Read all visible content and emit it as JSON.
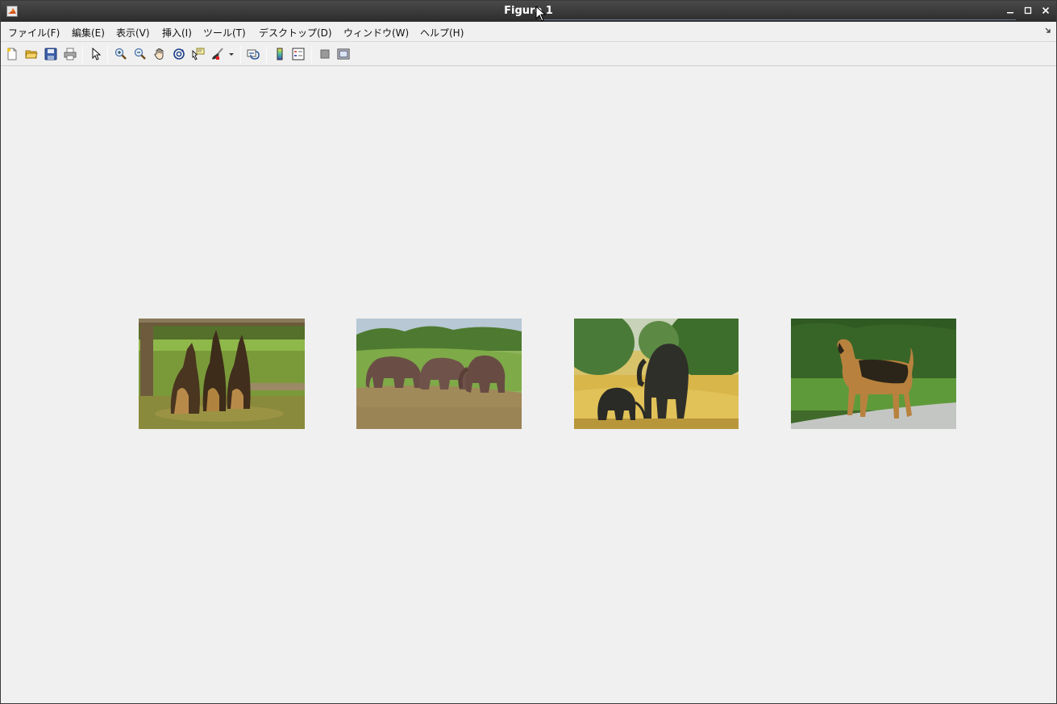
{
  "window": {
    "title": "Figure 1",
    "app_icon": "matlab-logo-icon",
    "controls": [
      "minimize-icon",
      "maximize-icon",
      "close-icon"
    ]
  },
  "menubar": {
    "items": [
      {
        "label": "ファイル(F)"
      },
      {
        "label": "編集(E)"
      },
      {
        "label": "表示(V)"
      },
      {
        "label": "挿入(I)"
      },
      {
        "label": "ツール(T)"
      },
      {
        "label": "デスクトップ(D)"
      },
      {
        "label": "ウィンドウ(W)"
      },
      {
        "label": "ヘルプ(H)"
      }
    ]
  },
  "toolbar": {
    "tools": [
      "new-figure-icon",
      "open-file-icon",
      "save-icon",
      "print-icon",
      "edit-plot-arrow-icon",
      "zoom-in-icon",
      "zoom-out-icon",
      "pan-hand-icon",
      "rotate-3d-icon",
      "data-cursor-icon",
      "brush-icon",
      "brush-dropdown-icon",
      "link-plot-icon",
      "colorbar-icon",
      "legend-icon",
      "hide-plot-tools-icon",
      "show-plot-tools-icon"
    ]
  },
  "images": [
    {
      "subject": "three german shepherd dogs sitting on grass by a fence"
    },
    {
      "subject": "three elephants on a grassy hill"
    },
    {
      "subject": "adult elephant and calf in yellow grass"
    },
    {
      "subject": "airedale terrier standing on lawn"
    }
  ],
  "colors": {
    "titlebar": "#2c2c2c",
    "background": "#f0f0f0",
    "menu_text": "#111111"
  }
}
